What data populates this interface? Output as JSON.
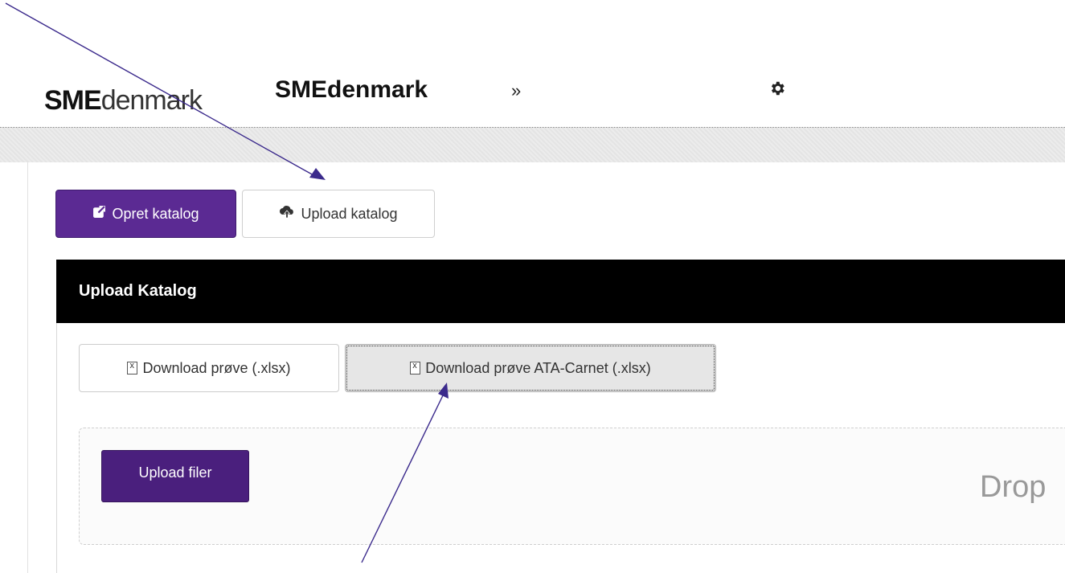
{
  "header": {
    "logo_bold": "SME",
    "logo_light": "denmark",
    "brand_title": "SMEdenmark",
    "separator": "»",
    "settings_icon": "gear-icon"
  },
  "toolbar": {
    "create_label": "Opret katalog",
    "create_icon": "external-link-icon",
    "upload_label": "Upload katalog",
    "upload_icon": "cloud-upload-icon"
  },
  "panel": {
    "title": "Upload Katalog",
    "download_sample_label": "Download prøve (.xlsx)",
    "download_ata_label": "Download prøve ATA-Carnet (.xlsx)",
    "file_icon": "excel-file-icon",
    "upload_files_label": "Upload filer",
    "drop_text": "Drop"
  },
  "colors": {
    "primary": "#5b2a93",
    "upload_button": "#4a1f7d",
    "panel_header": "#000000",
    "annotation_arrow": "#3b2a8c"
  }
}
